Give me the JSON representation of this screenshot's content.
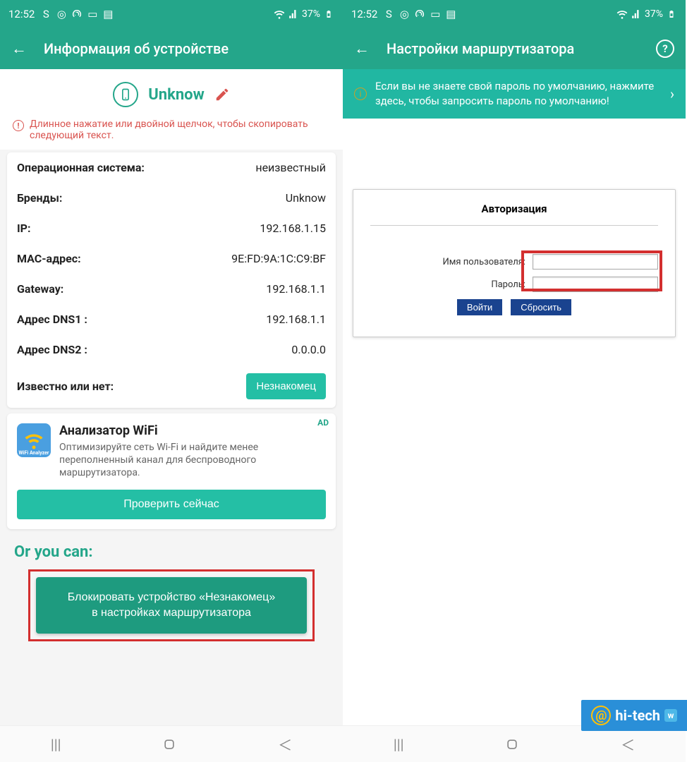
{
  "status": {
    "time": "12:52",
    "battery": "37%"
  },
  "left": {
    "title": "Информация об устройстве",
    "device_name": "Unknow",
    "hint": "Длинное нажатие или двойной щелчок, чтобы скопировать следующий текст.",
    "rows": {
      "os_label": "Операционная система:",
      "os_value": "неизвестный",
      "brand_label": "Бренды:",
      "brand_value": "Unknow",
      "ip_label": "IP:",
      "ip_value": "192.168.1.15",
      "mac_label": "MAC-адрес:",
      "mac_value": "9E:FD:9A:1C:C9:BF",
      "gateway_label": "Gateway:",
      "gateway_value": "192.168.1.1",
      "dns1_label": "Адрес DNS1 :",
      "dns1_value": "192.168.1.1",
      "dns2_label": "Адрес DNS2 :",
      "dns2_value": "0.0.0.0",
      "known_label": "Известно или нет:",
      "known_value": "Незнакомец"
    },
    "ad": {
      "label": "AD",
      "icon_text": "WiFi Analyzer",
      "title": "Анализатор WiFi",
      "desc": "Оптимизируйте сеть Wi-Fi и найдите менее переполненный канал для беспроводного маршрутизатора.",
      "button": "Проверить сейчас"
    },
    "or_text": "Or you can:",
    "block_button": "Блокировать устройство «Незнакомец»\nв настройках маршрутизатора"
  },
  "right": {
    "title": "Настройки маршрутизатора",
    "banner": "Если вы не знаете свой пароль по умолчанию, нажмите здесь, чтобы запросить пароль по умолчанию!",
    "login": {
      "title": "Авторизация",
      "user_label": "Имя пользователя:",
      "pass_label": "Пароль:",
      "submit": "Войти",
      "reset": "Сбросить"
    }
  },
  "watermark": "hi-tech"
}
